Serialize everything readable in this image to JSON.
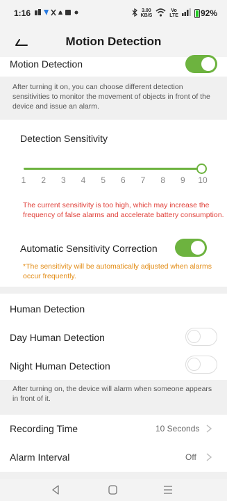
{
  "status_bar": {
    "time": "1:16",
    "speed_value": "3.00",
    "speed_unit": "KB/S",
    "network_top": "Vo",
    "network_bottom": "LTE",
    "battery": "92%"
  },
  "header": {
    "title": "Motion Detection"
  },
  "motion_detection": {
    "label": "Motion Detection",
    "enabled": true,
    "description": "After turning it on, you can choose different detection sensitivities to monitor the movement of objects in front of the device and issue an alarm."
  },
  "sensitivity": {
    "label": "Detection Sensitivity",
    "ticks": [
      "1",
      "2",
      "3",
      "4",
      "5",
      "6",
      "7",
      "8",
      "9",
      "10"
    ],
    "value": 10,
    "warning": "The current sensitivity is too high, which may increase the frequency of false alarms and accelerate battery consumption.",
    "auto_correction_label": "Automatic Sensitivity Correction",
    "auto_correction_enabled": true,
    "auto_correction_note": "*The sensitivity will be automatically adjusted when alarms occur frequently."
  },
  "human_detection": {
    "section_label": "Human Detection",
    "day_label": "Day Human Detection",
    "day_enabled": false,
    "night_label": "Night Human Detection",
    "night_enabled": false,
    "description": "After turning on, the device will alarm when someone appears in front of it."
  },
  "recording_time": {
    "label": "Recording Time",
    "value": "10 Seconds"
  },
  "alarm_interval": {
    "label": "Alarm Interval",
    "value": "Off"
  },
  "colors": {
    "accent": "#6db33f",
    "warning_red": "#e0413a",
    "note_orange": "#e28a12"
  },
  "icons": [
    "back-arrow-icon",
    "chevron-right-icon",
    "nav-back-icon",
    "nav-home-icon",
    "nav-menu-icon"
  ]
}
